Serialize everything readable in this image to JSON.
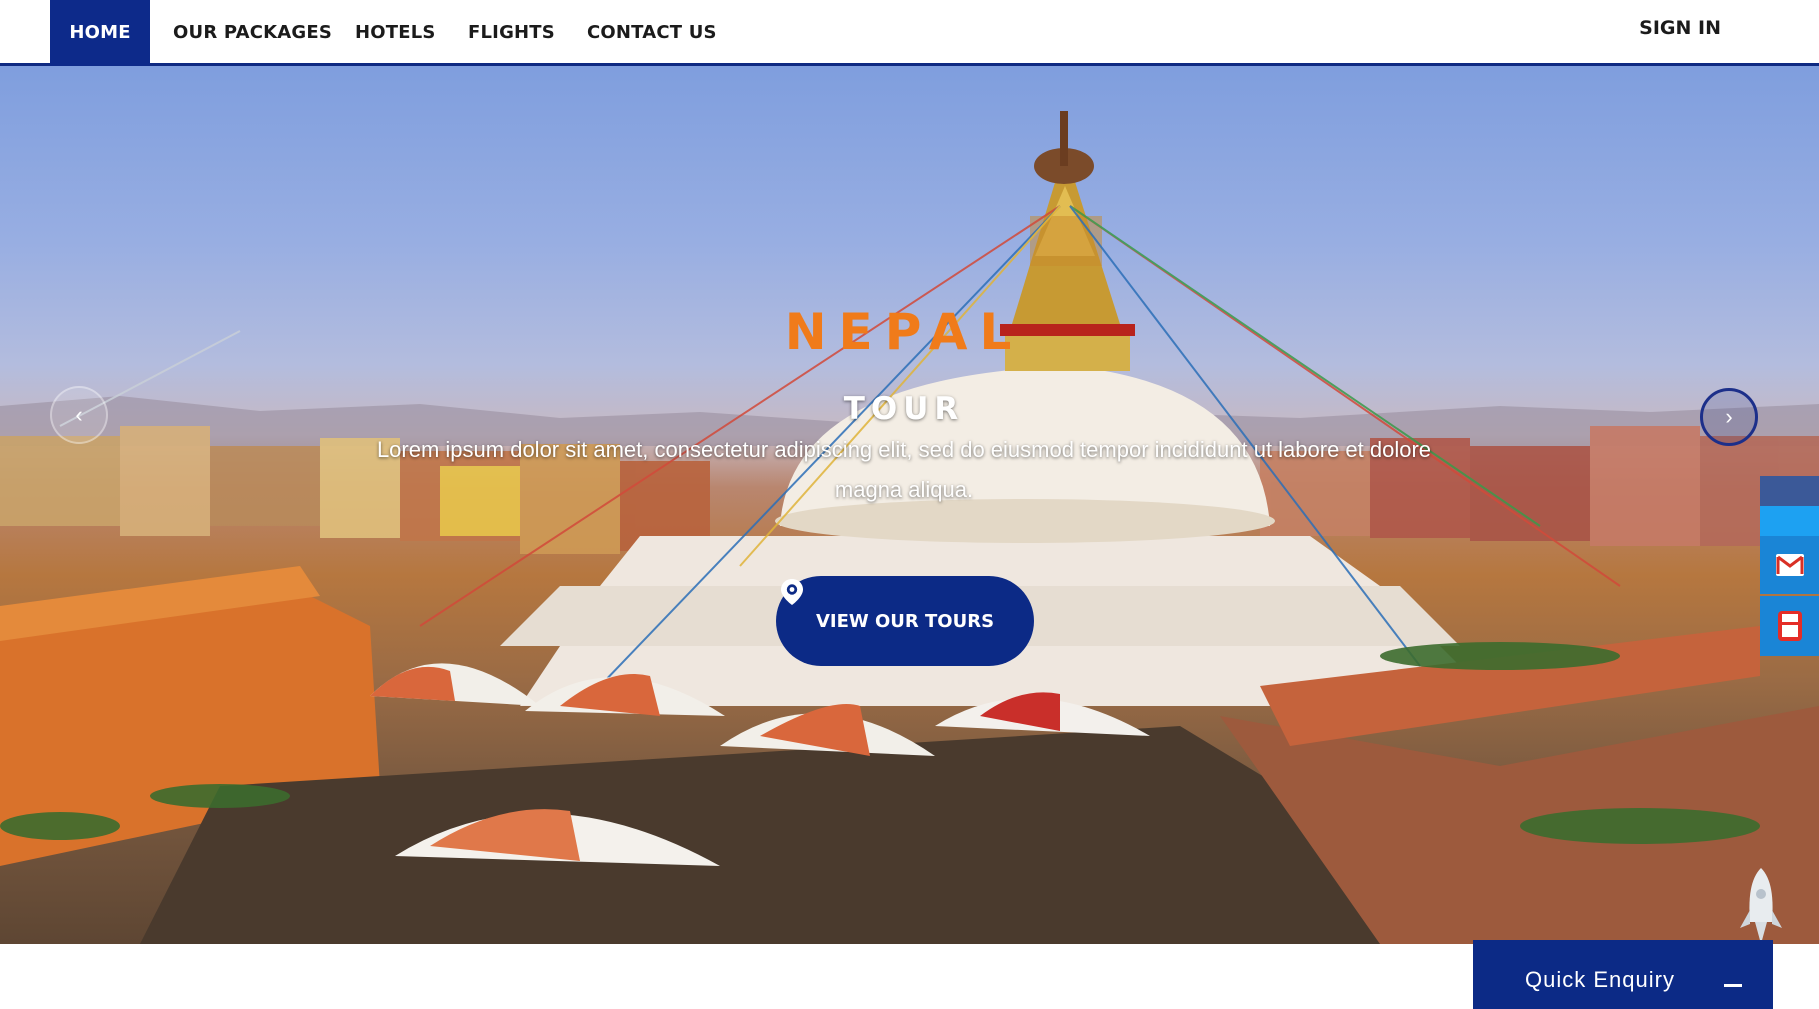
{
  "nav": {
    "items": [
      {
        "label": "HOME",
        "active": true
      },
      {
        "label": "OUR PACKAGES",
        "active": false
      },
      {
        "label": "HOTELS",
        "active": false
      },
      {
        "label": "FLIGHTS",
        "active": false
      },
      {
        "label": "CONTACT US",
        "active": false
      }
    ],
    "signin": "SIGN IN"
  },
  "hero": {
    "title": "NEPAL",
    "subtitle": "TOUR",
    "text": "Lorem ipsum dolor sit amet, consectetur adipiscing elit, sed do eiusmod tempor incididunt ut labore et dolore magna aliqua.",
    "cta": "VIEW OUR TOURS",
    "prev_icon": "chevron-left-icon",
    "next_icon": "chevron-right-icon"
  },
  "social": [
    {
      "name": "facebook-icon",
      "color": "#3b5998"
    },
    {
      "name": "twitter-icon",
      "color": "#1da1f2"
    },
    {
      "name": "gmail-icon",
      "color": "#1a85d6"
    },
    {
      "name": "youtube-icon",
      "color": "#1a85d6"
    }
  ],
  "enquiry": {
    "label": "Quick Enquiry"
  },
  "colors": {
    "primary": "#0c2a86",
    "accent": "#f07b1a"
  }
}
